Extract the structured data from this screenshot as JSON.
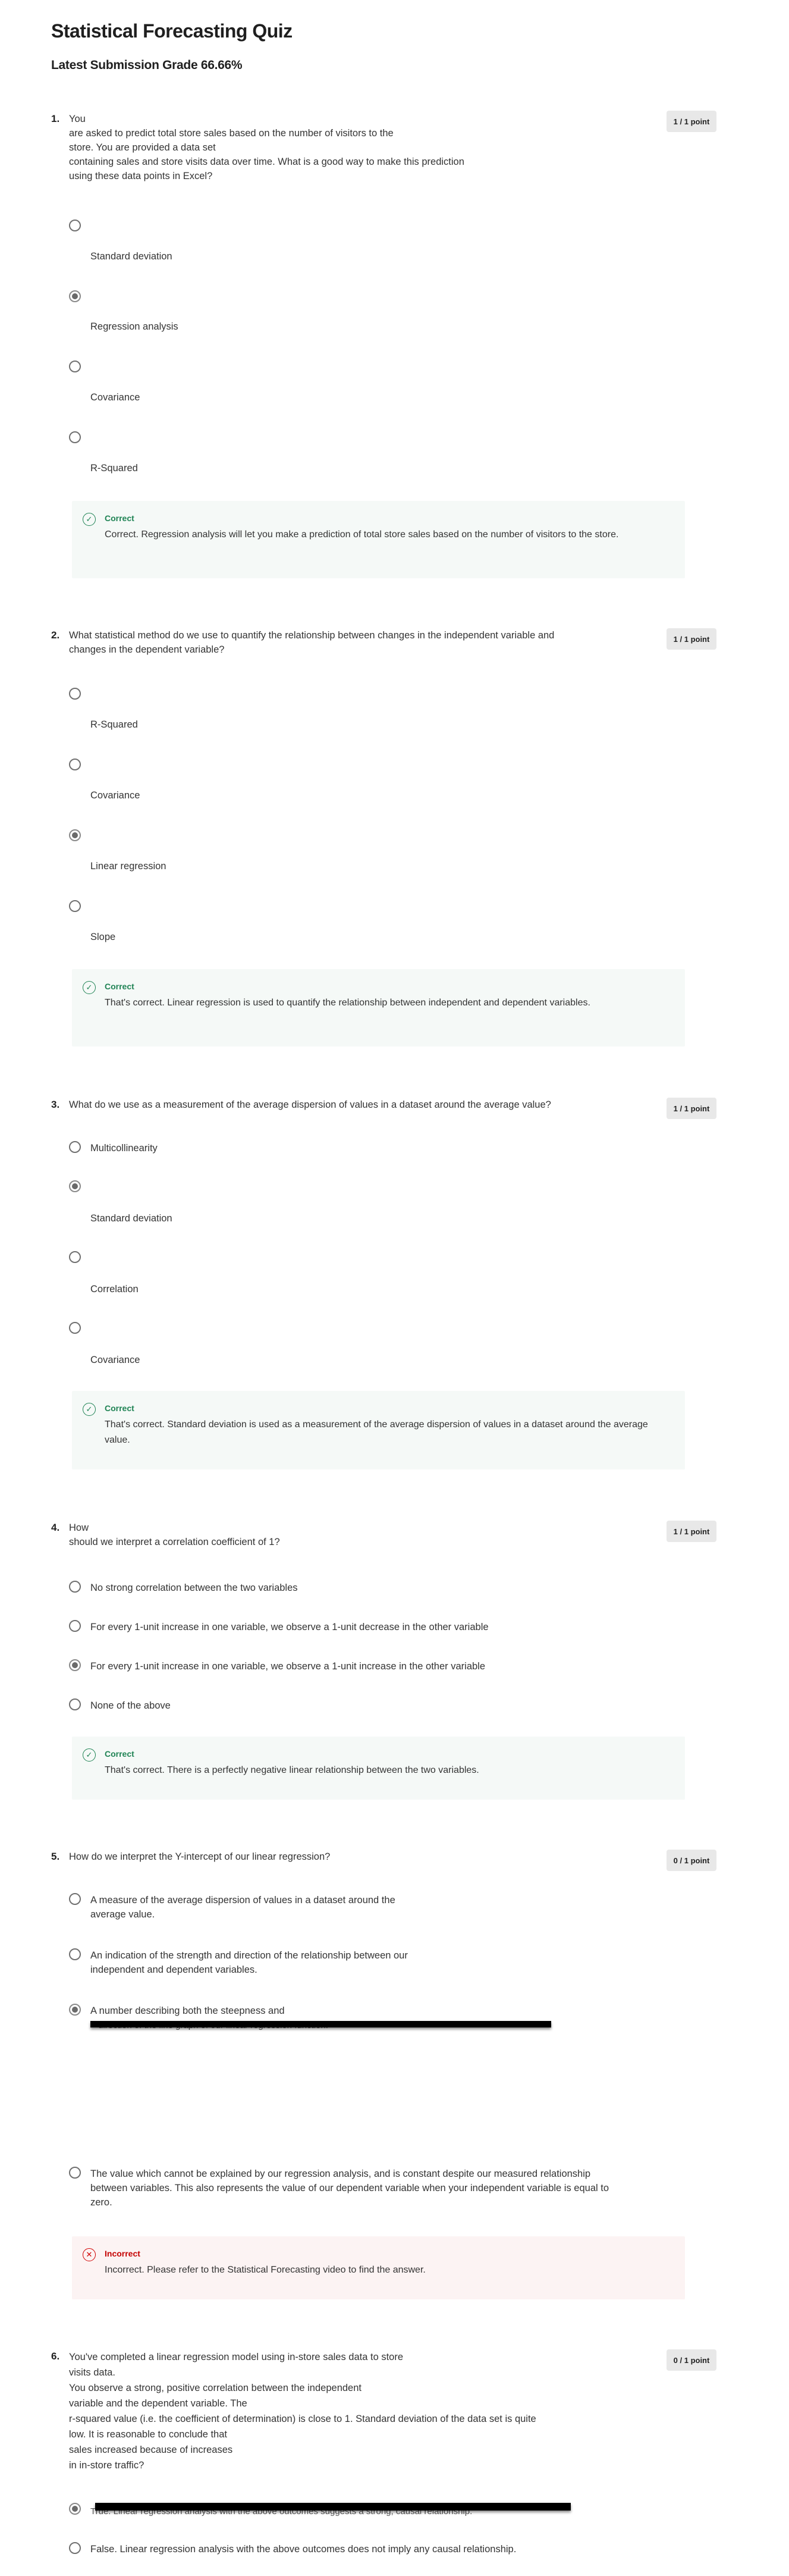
{
  "page": {
    "title": "Statistical Forecasting Quiz",
    "grade": "Latest Submission Grade 66.66%"
  },
  "questions": [
    {
      "number": "1.",
      "text": "You\nare asked to predict total store sales based on the number of visitors to the\nstore.  You are provided a data set\ncontaining sales and store visits data over time.  What is a good way to make this prediction\nusing these data points in Excel?",
      "score": "1 / 1 point",
      "options": [
        "Standard deviation",
        "Regression analysis",
        "Covariance",
        "R-Squared"
      ],
      "selected": 1,
      "feedback": {
        "status": "Correct",
        "text": "Correct.  Regression analysis will let you make a prediction of total store sales based on the number of visitors to the store."
      }
    },
    {
      "number": "2.",
      "text": "What statistical method do we use to quantify the relationship between changes in the independent variable and\nchanges in the dependent variable?",
      "score": "1 / 1 point",
      "options": [
        "R-Squared",
        "Covariance",
        "Linear regression",
        "Slope"
      ],
      "selected": 2,
      "feedback": {
        "status": "Correct",
        "text": "That's correct. Linear regression is used to quantify the relationship between independent and dependent variables."
      }
    },
    {
      "number": "3.",
      "text": "What do we use as a measurement of the average dispersion of values in a dataset around the average value?",
      "score": "1 / 1 point",
      "options": [
        "Multicollinearity",
        "Standard deviation",
        "Correlation",
        "Covariance"
      ],
      "selected": 1,
      "feedback": {
        "status": "Correct",
        "text": "That's correct. Standard deviation is used as a measurement of the average dispersion of values in a dataset around the average value."
      }
    },
    {
      "number": "4.",
      "text": "How\nshould we interpret a correlation coefficient of 1?",
      "score": "1 / 1 point",
      "options": [
        "No strong correlation between the two variables",
        "For every 1-unit increase in one variable, we observe a 1-unit decrease in the other variable",
        "For every 1-unit increase in one variable, we observe a 1-unit increase in the other variable",
        "None of the above"
      ],
      "selected": 2,
      "feedback": {
        "status": "Correct",
        "text": "That's correct.  There is a perfectly negative linear relationship between the two variables."
      }
    },
    {
      "number": "5.",
      "text": "How do we interpret the Y-intercept of our linear regression?",
      "score": "0 / 1 point",
      "options": [
        "A measure of the average dispersion of values in a dataset around the\naverage value.",
        "An indication of the strength and direction of the relationship between our\nindependent and dependent variables.",
        "A number describing both the steepness and",
        "The value which cannot be explained by our regression analysis, and is constant despite our measured relationship between variables. This also represents the value of our dependent variable when your independent variable is equal to zero."
      ],
      "selected": 2,
      "redacted_line": "direction of the line graph of our linear regression function.",
      "feedback": {
        "status": "Incorrect",
        "text": "Incorrect. Please refer to the Statistical Forecasting video to find the answer."
      }
    },
    {
      "number": "6.",
      "text": "You've completed a linear regression model using in-store sales data  to store\nvisits data.\nYou observe a strong, positive correlation between the independent\nvariable and the dependent variable.  The\nr-squared value (i.e. the coefficient of determination) is close to 1.  Standard deviation of the data set is quite\nlow.  It is reasonable to conclude that\nsales increased because of increases\nin in-store traffic?",
      "score": "0 / 1 point",
      "options": [
        "True. Linear regression analysis with the above outcomes suggests a strong, causal relationship.",
        "False. Linear regression analysis with the above outcomes does not imply any causal relationship."
      ],
      "selected": 0
    }
  ],
  "colors": {
    "correct": "#1f8354",
    "incorrect": "#c40000",
    "correct_bg": "#f5f9f7",
    "incorrect_bg": "#fcf3f3",
    "badge_bg": "#e8e8e8"
  },
  "icons": {
    "correct": "check-circle-icon",
    "incorrect": "x-circle-icon"
  }
}
